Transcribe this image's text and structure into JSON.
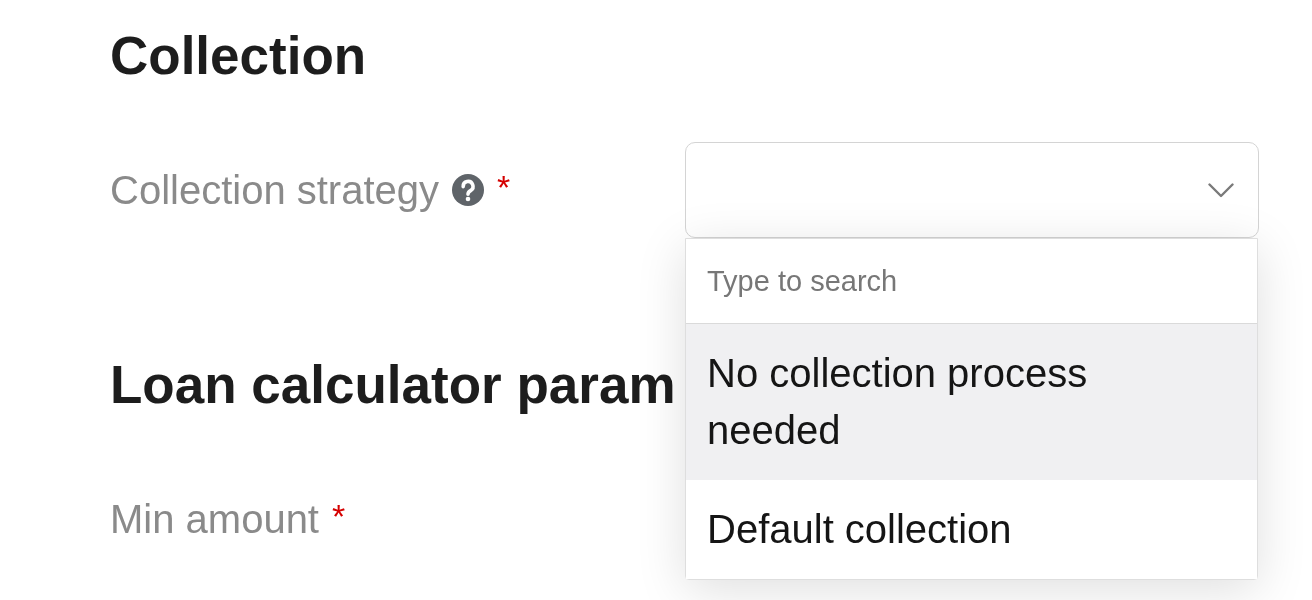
{
  "sections": [
    {
      "title": "Collection",
      "fields": [
        {
          "label": "Collection strategy",
          "help": true,
          "required_mark": "*",
          "select": {
            "expanded": true,
            "search": {
              "placeholder": "Type to search"
            },
            "options": [
              {
                "label": "No collection process needed",
                "highlighted": true
              },
              {
                "label": "Default collection",
                "highlighted": false
              }
            ]
          }
        }
      ]
    },
    {
      "title": "Loan calculator param",
      "fields": [
        {
          "label": "Min amount",
          "help": false,
          "required_mark": "*"
        }
      ]
    }
  ]
}
